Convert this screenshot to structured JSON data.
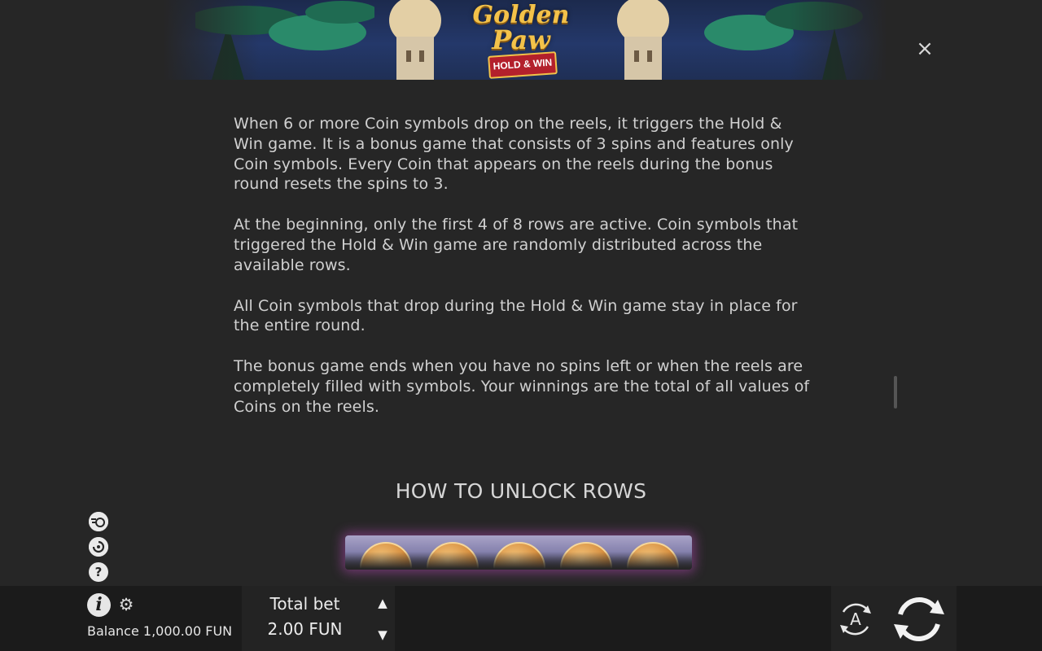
{
  "header": {
    "logo_line1": "Golden",
    "logo_line2": "Paw",
    "logo_ribbon": "HOLD & WIN",
    "close_symbol": "×"
  },
  "content": {
    "paragraphs": [
      "When 6 or more Coin symbols drop on the reels, it triggers the Hold & Win game. It is a bonus game that consists of 3 spins and features only Coin symbols. Every Coin that appears on the reels during the bonus round resets the spins to 3.",
      "At the beginning, only the first 4 of 8 rows are active. Coin symbols that triggered the Hold & Win game are randomly distributed across the available rows.",
      "All Coin symbols that drop during the Hold & Win game stay in place for the entire round.",
      "The bonus game ends when you have no spins left or when the reels are completely filled with symbols. Your winnings are the total of all values of Coins on the reels."
    ],
    "section_title": "HOW TO UNLOCK ROWS"
  },
  "side_icons": {
    "turbo": "turbo-icon",
    "history": "history-icon",
    "help_symbol": "?"
  },
  "bottom": {
    "info_symbol": "i",
    "gear_symbol": "⚙",
    "balance": "Balance 1,000.00 FUN",
    "total_bet_label": "Total bet",
    "total_bet_value": "2.00 FUN",
    "bet_up_symbol": "▲",
    "bet_down_symbol": "▼",
    "autoplay_letter": "A"
  },
  "colors": {
    "background": "#262626",
    "bottom_bar": "#1b1b1b",
    "text": "#d0d0d0",
    "logo_gold": "#f3c24a",
    "ribbon_red": "#b3202c"
  }
}
